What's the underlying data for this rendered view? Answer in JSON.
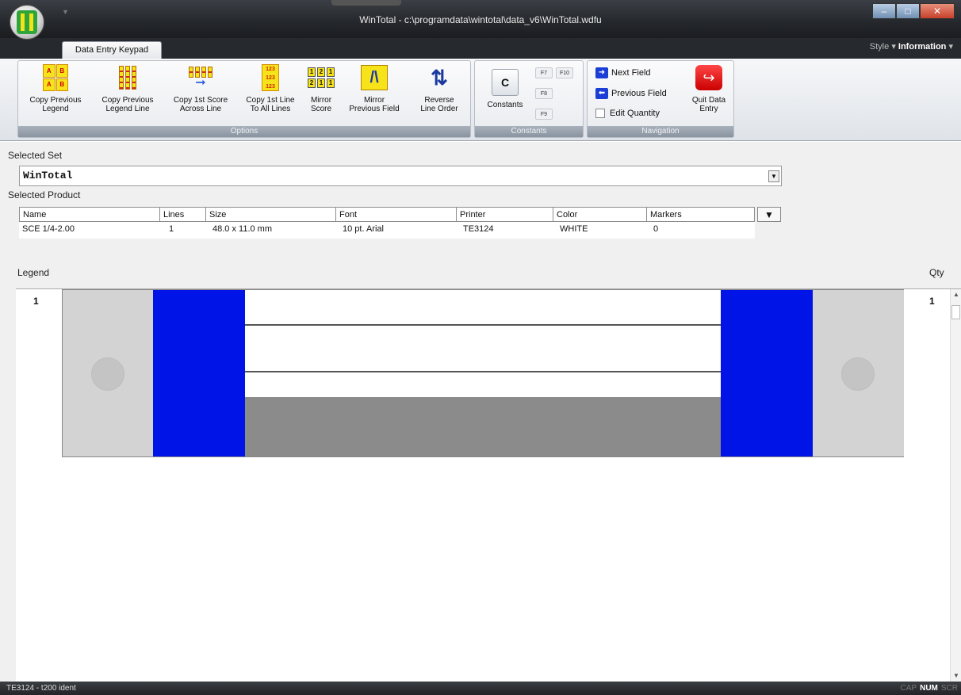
{
  "window": {
    "title": "WinTotal - c:\\programdata\\wintotal\\data_v6\\WinTotal.wdfu",
    "minimize": "–",
    "maximize": "□",
    "close": "✕",
    "style_label": "Style",
    "information_label": "Information"
  },
  "ribbon": {
    "active_tab": "Data Entry Keypad",
    "groups": {
      "options": "Options",
      "constants": "Constants",
      "navigation": "Navigation"
    },
    "options": {
      "copy_prev_legend": [
        "Copy Previous",
        "Legend"
      ],
      "copy_prev_legend_line": [
        "Copy Previous",
        "Legend Line"
      ],
      "copy_first_score": [
        "Copy 1st Score",
        "Across Line"
      ],
      "copy_first_line": [
        "Copy 1st Line",
        "To All Lines"
      ],
      "mirror_score": [
        "Mirror",
        "Score"
      ],
      "mirror_prev_field": [
        "Mirror",
        "Previous Field"
      ],
      "reverse_line_order": [
        "Reverse",
        "Line Order"
      ]
    },
    "constants": {
      "label": "Constants",
      "key": "C",
      "fkeys": [
        "F7",
        "F10",
        "F8",
        "F9"
      ]
    },
    "navigation": {
      "next_field": "Next Field",
      "previous_field": "Previous Field",
      "edit_quantity": "Edit Quantity",
      "quit": [
        "Quit Data",
        "Entry"
      ]
    }
  },
  "selected_set": {
    "label": "Selected Set",
    "value": "WinTotal"
  },
  "selected_product": {
    "label": "Selected Product",
    "columns": [
      "Name",
      "Lines",
      "Size",
      "Font",
      "Printer",
      "Color",
      "Markers"
    ],
    "row": [
      "SCE 1/4-2.00",
      "1",
      "48.0 x 11.0 mm",
      "10 pt. Arial",
      "TE3124",
      "WHITE",
      "0"
    ]
  },
  "legend": {
    "label": "Legend",
    "qty_label": "Qty",
    "row_number": "1",
    "quantity": "1"
  },
  "colors": {
    "marker_blue": "#0014e8",
    "marker_grey": "#d3d3d3"
  },
  "statusbar": {
    "text": "TE3124 - t200 ident",
    "cap": "CAP",
    "num": "NUM",
    "scr": "SCR"
  }
}
